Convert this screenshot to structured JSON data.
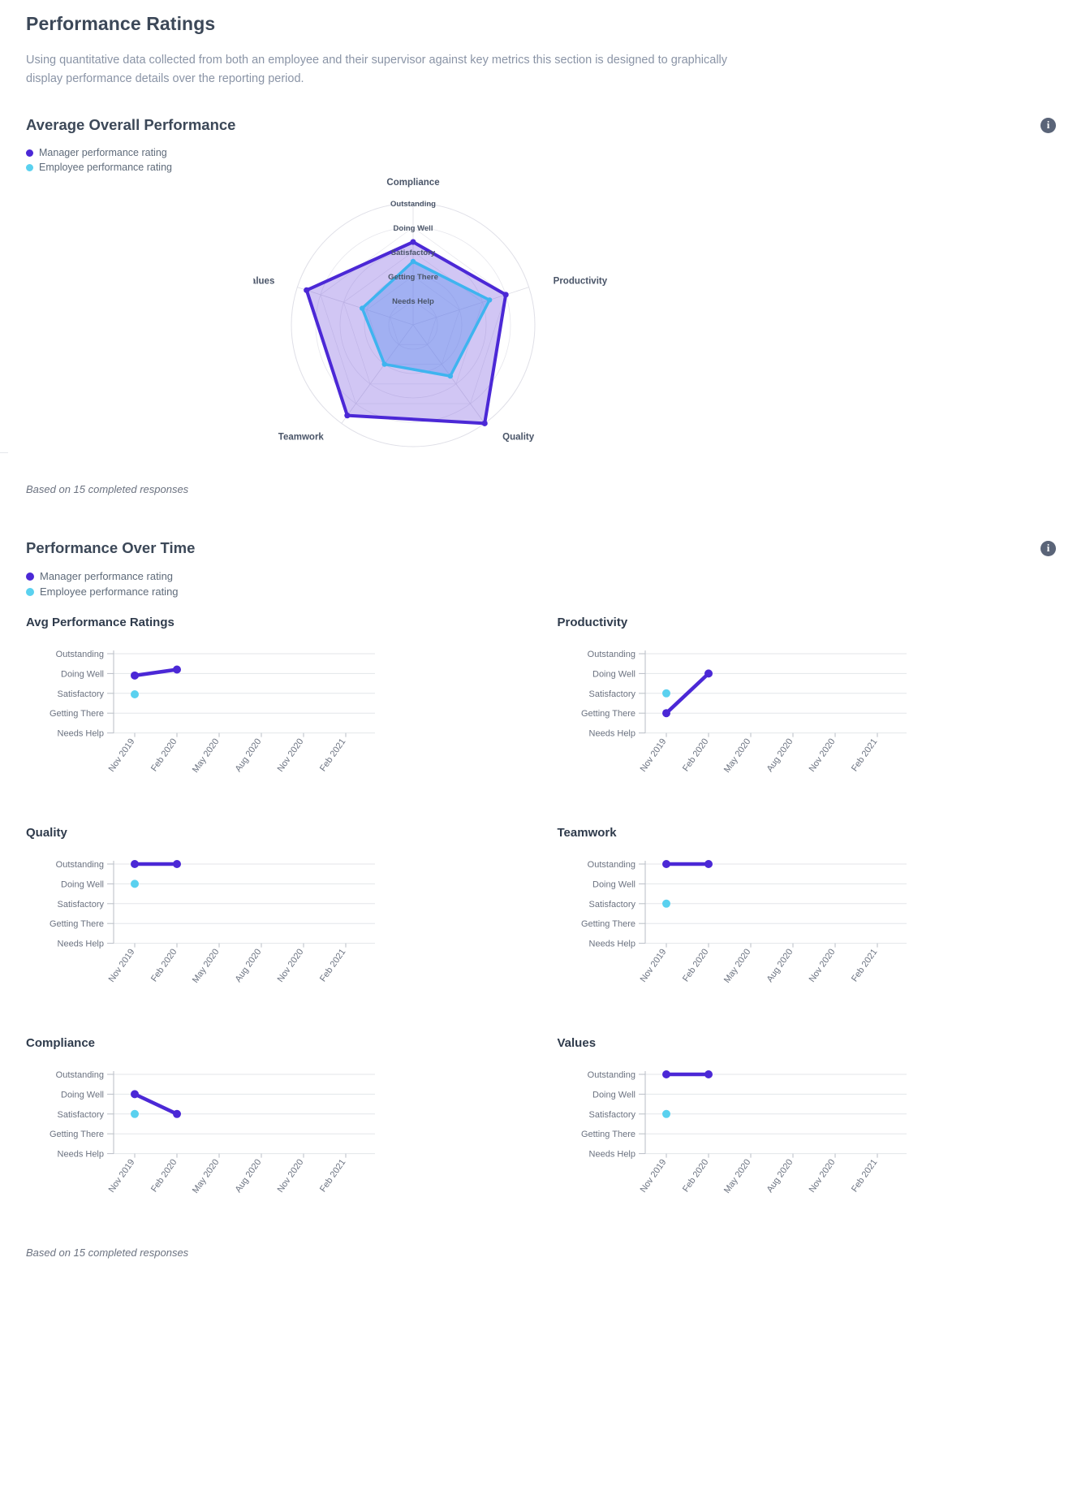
{
  "page": {
    "title": "Performance Ratings",
    "description": "Using quantitative data collected from both an employee and their supervisor against key metrics this section is designed to graphically display performance details over the reporting period."
  },
  "legend": {
    "manager": "Manager performance rating",
    "employee": "Employee performance rating",
    "manager_color": "#4b28d6",
    "employee_color": "#5ad1ef"
  },
  "info_icon": {
    "glyph": "i",
    "name": "info-icon"
  },
  "sections": {
    "overall": {
      "title": "Average Overall Performance",
      "caption": "Based on 15 completed responses"
    },
    "over_time": {
      "title": "Performance Over Time",
      "caption": "Based on 15 completed responses"
    }
  },
  "scale_labels": [
    "Needs Help",
    "Getting There",
    "Satisfactory",
    "Doing Well",
    "Outstanding"
  ],
  "chart_data": [
    {
      "type": "radar",
      "title": "Average Overall Performance",
      "categories": [
        "Compliance",
        "Productivity",
        "Quality",
        "Teamwork",
        "Values"
      ],
      "rings": [
        "Needs Help",
        "Getting There",
        "Satisfactory",
        "Doing Well",
        "Outstanding"
      ],
      "ylim": [
        0,
        5
      ],
      "legend_position": "top-left",
      "grid": true,
      "series": [
        {
          "name": "Manager performance rating",
          "color": "#4b28d6",
          "values": [
            3.4,
            4.0,
            5.0,
            4.6,
            4.6
          ]
        },
        {
          "name": "Employee performance rating",
          "color": "#3eb4ef",
          "values": [
            2.6,
            3.3,
            2.6,
            2.0,
            2.2
          ]
        }
      ]
    },
    {
      "type": "line",
      "title": "Avg Performance Ratings",
      "x": [
        "Nov 2019",
        "Feb 2020",
        "May 2020",
        "Aug 2020",
        "Nov 2020",
        "Feb 2021"
      ],
      "ylabels": [
        "Needs Help",
        "Getting There",
        "Satisfactory",
        "Doing Well",
        "Outstanding"
      ],
      "ylim": [
        0,
        5
      ],
      "grid": true,
      "series": [
        {
          "name": "Manager performance rating",
          "color": "#4b28d6",
          "values": [
            3.9,
            4.2,
            null,
            null,
            null,
            null
          ]
        },
        {
          "name": "Employee performance rating",
          "color": "#5ad1ef",
          "values": [
            2.95,
            null,
            null,
            null,
            null,
            null
          ]
        }
      ]
    },
    {
      "type": "line",
      "title": "Productivity",
      "x": [
        "Nov 2019",
        "Feb 2020",
        "May 2020",
        "Aug 2020",
        "Nov 2020",
        "Feb 2021"
      ],
      "ylabels": [
        "Needs Help",
        "Getting There",
        "Satisfactory",
        "Doing Well",
        "Outstanding"
      ],
      "ylim": [
        0,
        5
      ],
      "grid": true,
      "series": [
        {
          "name": "Manager performance rating",
          "color": "#4b28d6",
          "values": [
            2.0,
            4.0,
            null,
            null,
            null,
            null
          ]
        },
        {
          "name": "Employee performance rating",
          "color": "#5ad1ef",
          "values": [
            3.0,
            null,
            null,
            null,
            null,
            null
          ]
        }
      ]
    },
    {
      "type": "line",
      "title": "Quality",
      "x": [
        "Nov 2019",
        "Feb 2020",
        "May 2020",
        "Aug 2020",
        "Nov 2020",
        "Feb 2021"
      ],
      "ylabels": [
        "Needs Help",
        "Getting There",
        "Satisfactory",
        "Doing Well",
        "Outstanding"
      ],
      "ylim": [
        0,
        5
      ],
      "grid": true,
      "series": [
        {
          "name": "Manager performance rating",
          "color": "#4b28d6",
          "values": [
            5.0,
            5.0,
            null,
            null,
            null,
            null
          ]
        },
        {
          "name": "Employee performance rating",
          "color": "#5ad1ef",
          "values": [
            4.0,
            null,
            null,
            null,
            null,
            null
          ]
        }
      ]
    },
    {
      "type": "line",
      "title": "Teamwork",
      "x": [
        "Nov 2019",
        "Feb 2020",
        "May 2020",
        "Aug 2020",
        "Nov 2020",
        "Feb 2021"
      ],
      "ylabels": [
        "Needs Help",
        "Getting There",
        "Satisfactory",
        "Doing Well",
        "Outstanding"
      ],
      "ylim": [
        0,
        5
      ],
      "grid": true,
      "series": [
        {
          "name": "Manager performance rating",
          "color": "#4b28d6",
          "values": [
            5.0,
            5.0,
            null,
            null,
            null,
            null
          ]
        },
        {
          "name": "Employee performance rating",
          "color": "#5ad1ef",
          "values": [
            3.0,
            null,
            null,
            null,
            null,
            null
          ]
        }
      ]
    },
    {
      "type": "line",
      "title": "Compliance",
      "x": [
        "Nov 2019",
        "Feb 2020",
        "May 2020",
        "Aug 2020",
        "Nov 2020",
        "Feb 2021"
      ],
      "ylabels": [
        "Needs Help",
        "Getting There",
        "Satisfactory",
        "Doing Well",
        "Outstanding"
      ],
      "ylim": [
        0,
        5
      ],
      "grid": true,
      "series": [
        {
          "name": "Manager performance rating",
          "color": "#4b28d6",
          "values": [
            4.0,
            3.0,
            null,
            null,
            null,
            null
          ]
        },
        {
          "name": "Employee performance rating",
          "color": "#5ad1ef",
          "values": [
            3.0,
            null,
            null,
            null,
            null,
            null
          ]
        }
      ]
    },
    {
      "type": "line",
      "title": "Values",
      "x": [
        "Nov 2019",
        "Feb 2020",
        "May 2020",
        "Aug 2020",
        "Nov 2020",
        "Feb 2021"
      ],
      "ylabels": [
        "Needs Help",
        "Getting There",
        "Satisfactory",
        "Doing Well",
        "Outstanding"
      ],
      "ylim": [
        0,
        5
      ],
      "grid": true,
      "series": [
        {
          "name": "Manager performance rating",
          "color": "#4b28d6",
          "values": [
            5.0,
            5.0,
            null,
            null,
            null,
            null
          ]
        },
        {
          "name": "Employee performance rating",
          "color": "#5ad1ef",
          "values": [
            3.0,
            null,
            null,
            null,
            null,
            null
          ]
        }
      ]
    }
  ]
}
